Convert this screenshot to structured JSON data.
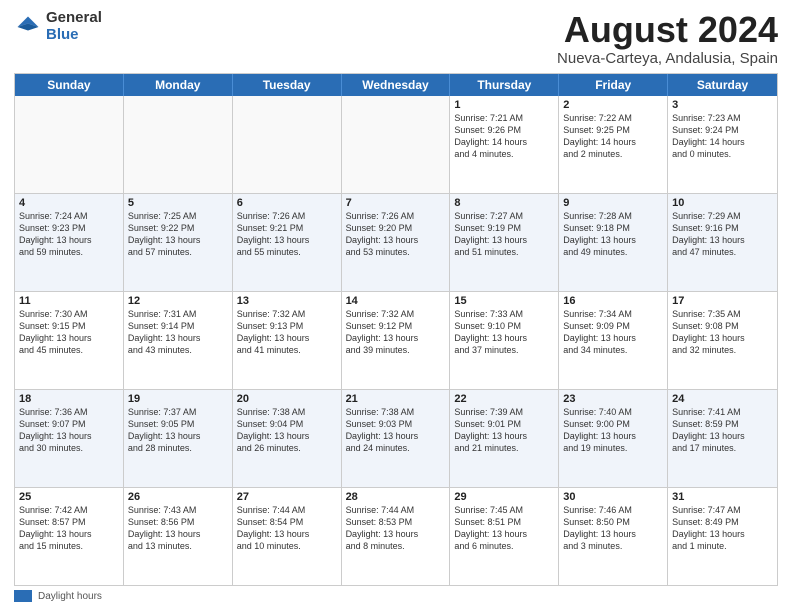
{
  "logo": {
    "general": "General",
    "blue": "Blue"
  },
  "title": "August 2024",
  "subtitle": "Nueva-Carteya, Andalusia, Spain",
  "days_of_week": [
    "Sunday",
    "Monday",
    "Tuesday",
    "Wednesday",
    "Thursday",
    "Friday",
    "Saturday"
  ],
  "footer_label": "Daylight hours",
  "weeks": [
    [
      {
        "num": "",
        "info": ""
      },
      {
        "num": "",
        "info": ""
      },
      {
        "num": "",
        "info": ""
      },
      {
        "num": "",
        "info": ""
      },
      {
        "num": "1",
        "info": "Sunrise: 7:21 AM\nSunset: 9:26 PM\nDaylight: 14 hours\nand 4 minutes."
      },
      {
        "num": "2",
        "info": "Sunrise: 7:22 AM\nSunset: 9:25 PM\nDaylight: 14 hours\nand 2 minutes."
      },
      {
        "num": "3",
        "info": "Sunrise: 7:23 AM\nSunset: 9:24 PM\nDaylight: 14 hours\nand 0 minutes."
      }
    ],
    [
      {
        "num": "4",
        "info": "Sunrise: 7:24 AM\nSunset: 9:23 PM\nDaylight: 13 hours\nand 59 minutes."
      },
      {
        "num": "5",
        "info": "Sunrise: 7:25 AM\nSunset: 9:22 PM\nDaylight: 13 hours\nand 57 minutes."
      },
      {
        "num": "6",
        "info": "Sunrise: 7:26 AM\nSunset: 9:21 PM\nDaylight: 13 hours\nand 55 minutes."
      },
      {
        "num": "7",
        "info": "Sunrise: 7:26 AM\nSunset: 9:20 PM\nDaylight: 13 hours\nand 53 minutes."
      },
      {
        "num": "8",
        "info": "Sunrise: 7:27 AM\nSunset: 9:19 PM\nDaylight: 13 hours\nand 51 minutes."
      },
      {
        "num": "9",
        "info": "Sunrise: 7:28 AM\nSunset: 9:18 PM\nDaylight: 13 hours\nand 49 minutes."
      },
      {
        "num": "10",
        "info": "Sunrise: 7:29 AM\nSunset: 9:16 PM\nDaylight: 13 hours\nand 47 minutes."
      }
    ],
    [
      {
        "num": "11",
        "info": "Sunrise: 7:30 AM\nSunset: 9:15 PM\nDaylight: 13 hours\nand 45 minutes."
      },
      {
        "num": "12",
        "info": "Sunrise: 7:31 AM\nSunset: 9:14 PM\nDaylight: 13 hours\nand 43 minutes."
      },
      {
        "num": "13",
        "info": "Sunrise: 7:32 AM\nSunset: 9:13 PM\nDaylight: 13 hours\nand 41 minutes."
      },
      {
        "num": "14",
        "info": "Sunrise: 7:32 AM\nSunset: 9:12 PM\nDaylight: 13 hours\nand 39 minutes."
      },
      {
        "num": "15",
        "info": "Sunrise: 7:33 AM\nSunset: 9:10 PM\nDaylight: 13 hours\nand 37 minutes."
      },
      {
        "num": "16",
        "info": "Sunrise: 7:34 AM\nSunset: 9:09 PM\nDaylight: 13 hours\nand 34 minutes."
      },
      {
        "num": "17",
        "info": "Sunrise: 7:35 AM\nSunset: 9:08 PM\nDaylight: 13 hours\nand 32 minutes."
      }
    ],
    [
      {
        "num": "18",
        "info": "Sunrise: 7:36 AM\nSunset: 9:07 PM\nDaylight: 13 hours\nand 30 minutes."
      },
      {
        "num": "19",
        "info": "Sunrise: 7:37 AM\nSunset: 9:05 PM\nDaylight: 13 hours\nand 28 minutes."
      },
      {
        "num": "20",
        "info": "Sunrise: 7:38 AM\nSunset: 9:04 PM\nDaylight: 13 hours\nand 26 minutes."
      },
      {
        "num": "21",
        "info": "Sunrise: 7:38 AM\nSunset: 9:03 PM\nDaylight: 13 hours\nand 24 minutes."
      },
      {
        "num": "22",
        "info": "Sunrise: 7:39 AM\nSunset: 9:01 PM\nDaylight: 13 hours\nand 21 minutes."
      },
      {
        "num": "23",
        "info": "Sunrise: 7:40 AM\nSunset: 9:00 PM\nDaylight: 13 hours\nand 19 minutes."
      },
      {
        "num": "24",
        "info": "Sunrise: 7:41 AM\nSunset: 8:59 PM\nDaylight: 13 hours\nand 17 minutes."
      }
    ],
    [
      {
        "num": "25",
        "info": "Sunrise: 7:42 AM\nSunset: 8:57 PM\nDaylight: 13 hours\nand 15 minutes."
      },
      {
        "num": "26",
        "info": "Sunrise: 7:43 AM\nSunset: 8:56 PM\nDaylight: 13 hours\nand 13 minutes."
      },
      {
        "num": "27",
        "info": "Sunrise: 7:44 AM\nSunset: 8:54 PM\nDaylight: 13 hours\nand 10 minutes."
      },
      {
        "num": "28",
        "info": "Sunrise: 7:44 AM\nSunset: 8:53 PM\nDaylight: 13 hours\nand 8 minutes."
      },
      {
        "num": "29",
        "info": "Sunrise: 7:45 AM\nSunset: 8:51 PM\nDaylight: 13 hours\nand 6 minutes."
      },
      {
        "num": "30",
        "info": "Sunrise: 7:46 AM\nSunset: 8:50 PM\nDaylight: 13 hours\nand 3 minutes."
      },
      {
        "num": "31",
        "info": "Sunrise: 7:47 AM\nSunset: 8:49 PM\nDaylight: 13 hours\nand 1 minute."
      }
    ]
  ]
}
